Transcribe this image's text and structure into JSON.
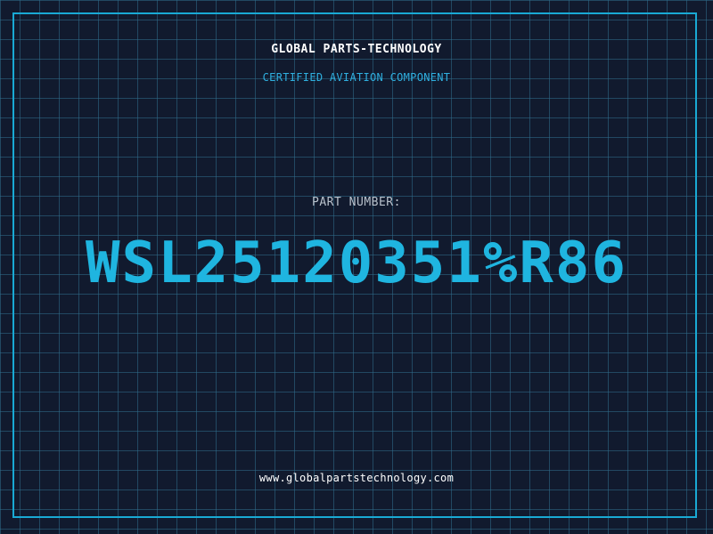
{
  "header": {
    "company_name": "GLOBAL PARTS-TECHNOLOGY",
    "subtitle": "CERTIFIED AVIATION COMPONENT"
  },
  "part": {
    "label": "PART NUMBER:",
    "number": "WSL25120351%R86"
  },
  "footer": {
    "website": "www.globalpartstechnology.com"
  },
  "colors": {
    "background": "#111a2e",
    "grid": "#306e8c",
    "frame": "#19a9d4",
    "accent": "#1fb5e0",
    "label": "#b9c2cc",
    "text": "#ffffff"
  }
}
